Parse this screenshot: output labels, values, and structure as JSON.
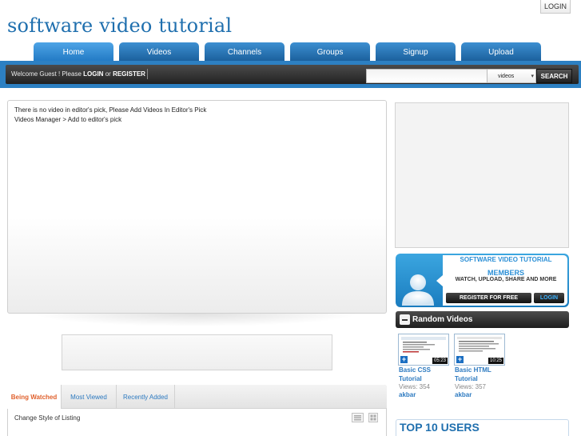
{
  "header": {
    "logo_text": "software video tutorial",
    "login_label": "LOGIN"
  },
  "nav": {
    "tabs": [
      {
        "label": "Home",
        "active": true
      },
      {
        "label": "Videos"
      },
      {
        "label": "Channels"
      },
      {
        "label": "Groups"
      },
      {
        "label": "Signup"
      },
      {
        "label": "Upload"
      }
    ]
  },
  "toolbar": {
    "welcome_prefix": "Welcome Guest ! Please",
    "login_link": "LOGIN",
    "or_text": "or",
    "register_link": "REGISTER",
    "search_placeholder": "",
    "search_type": "videos",
    "search_button": "SEARCH"
  },
  "editors_pick": {
    "line1": "There is no video in editor's pick, Please Add Videos In Editor's Pick",
    "line2": "Videos Manager > Add to editor's pick"
  },
  "listing": {
    "tabs": [
      {
        "label": "Being Watched",
        "active": true
      },
      {
        "label": "Most Viewed"
      },
      {
        "label": "Recently Added"
      }
    ],
    "change_style": "Change Style of Listing"
  },
  "members_box": {
    "title": "SOFTWARE VIDEO TUTORIAL",
    "subtitle": "MEMBERS",
    "tagline": "WATCH, UPLOAD, SHARE AND MORE",
    "register_button": "REGISTER FOR FREE",
    "login_button": "LOGIN"
  },
  "random_videos": {
    "header": "Random Videos",
    "items": [
      {
        "title_line1": "Basic CSS",
        "title_line2": "Tutorial",
        "views": "Views: 354",
        "user": "akbar",
        "duration": "05:23"
      },
      {
        "title_line1": "Basic HTML",
        "title_line2": "Tutorial",
        "views": "Views: 357",
        "user": "akbar",
        "duration": "10:25"
      }
    ]
  },
  "top_users": {
    "title": "TOP 10 USERS"
  },
  "colors": {
    "brand_blue": "#2d80c2",
    "link_blue": "#2d7ac0",
    "active_tab_orange": "#e0612d",
    "dark_bar": "#222222"
  }
}
